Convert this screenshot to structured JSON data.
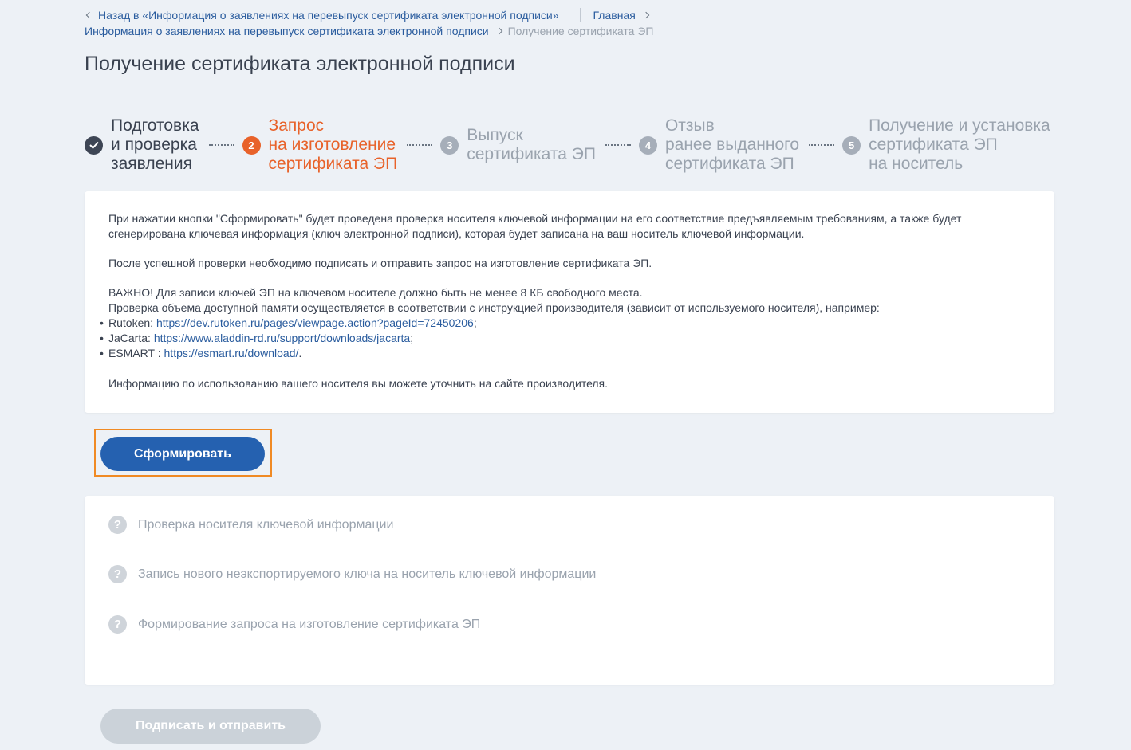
{
  "breadcrumbs": {
    "back_label": "Назад в «Информация о заявлениях на перевыпуск сертификата электронной подписи»",
    "home_label": "Главная",
    "parent_label": "Информация о заявлениях на перевыпуск сертификата электронной подписи",
    "current_label": "Получение сертификата ЭП"
  },
  "page_title": "Получение сертификата электронной подписи",
  "steps": [
    {
      "number": "",
      "state": "done",
      "label": "Подготовка\nи проверка\nзаявления"
    },
    {
      "number": "2",
      "state": "active",
      "label": "Запрос\nна изготовление\nсертификата ЭП"
    },
    {
      "number": "3",
      "state": "pending",
      "label": "Выпуск\nсертификата ЭП"
    },
    {
      "number": "4",
      "state": "pending",
      "label": "Отзыв\nранее выданного\nсертификата ЭП"
    },
    {
      "number": "5",
      "state": "pending",
      "label": "Получение и установка\nсертификата ЭП\nна носитель"
    }
  ],
  "info": {
    "paragraph1": "При нажатии кнопки \"Сформировать\" будет проведена проверка носителя ключевой информации на его соответствие предъявляемым требованиям, а также будет сгенерирована ключевая информация (ключ электронной подписи), которая будет записана на ваш носитель ключевой информации.",
    "paragraph2": "После успешной проверки необходимо подписать и отправить запрос на изготовление сертификата ЭП.",
    "important_line1": "ВАЖНО! Для записи ключей ЭП на ключевом носителе должно быть не менее 8 КБ свободного места.",
    "important_line2": "Проверка объема доступной памяти осуществляется в соответствии с инструкцией производителя (зависит от используемого носителя), например:",
    "vendors": [
      {
        "name": "Rutoken: ",
        "url": "https://dev.rutoken.ru/pages/viewpage.action?pageId=72450206",
        "end": ";"
      },
      {
        "name": "JaCarta: ",
        "url": "https://www.aladdin-rd.ru/support/downloads/jacarta",
        "end": ";"
      },
      {
        "name": "ESMART : ",
        "url": "https://esmart.ru/download/",
        "end": "."
      }
    ],
    "footer": "Информацию по использованию вашего носителя вы можете уточнить на сайте производителя."
  },
  "actions": {
    "generate_label": "Сформировать",
    "sign_send_label": "Подписать и отправить"
  },
  "status_items": [
    {
      "label": "Проверка носителя ключевой информации"
    },
    {
      "label": "Запись нового неэкспортируемого ключа на носитель ключевой информации"
    },
    {
      "label": "Формирование запроса на изготовление сертификата ЭП"
    }
  ],
  "colors": {
    "primary": "#2561b0",
    "active_step": "#e8622a",
    "highlight_border": "#f08a24",
    "pending": "#9aa3ae"
  }
}
